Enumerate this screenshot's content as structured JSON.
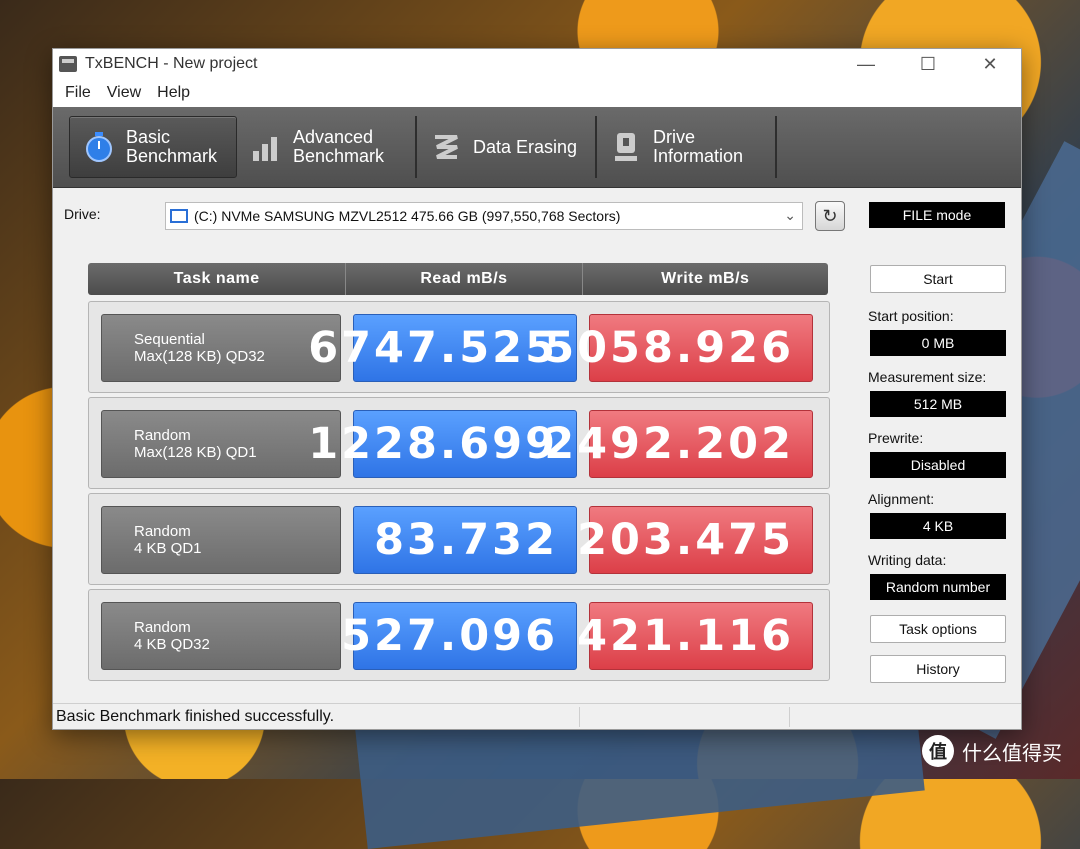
{
  "window": {
    "title": "TxBENCH - New project"
  },
  "menu": [
    "File",
    "View",
    "Help"
  ],
  "tabs": [
    {
      "line1": "Basic",
      "line2": "Benchmark",
      "icon": "stopwatch-icon"
    },
    {
      "line1": "Advanced",
      "line2": "Benchmark",
      "icon": "bar-chart-icon"
    },
    {
      "line1": "Data Erasing",
      "line2": "",
      "icon": "eraser-icon"
    },
    {
      "line1": "Drive",
      "line2": "Information",
      "icon": "drive-info-icon"
    }
  ],
  "drive": {
    "label": "Drive:",
    "value": "(C:) NVMe SAMSUNG MZVL2512  475.66 GB (997,550,768 Sectors)",
    "mode": "FILE mode"
  },
  "table": {
    "headers": [
      "Task name",
      "Read mB/s",
      "Write mB/s"
    ],
    "rows": [
      {
        "line1": "Sequential",
        "line2": "Max(128 KB) QD32",
        "read": "6747.525",
        "write": "5058.926"
      },
      {
        "line1": "Random",
        "line2": "Max(128 KB) QD1",
        "read": "1228.699",
        "write": "2492.202"
      },
      {
        "line1": "Random",
        "line2": "4 KB QD1",
        "read": "83.732",
        "write": "203.475"
      },
      {
        "line1": "Random",
        "line2": "4 KB QD32",
        "read": "527.096",
        "write": "421.116"
      }
    ]
  },
  "side": {
    "start": "Start",
    "start_position_label": "Start position:",
    "start_position": "0 MB",
    "measurement_size_label": "Measurement size:",
    "measurement_size": "512 MB",
    "prewrite_label": "Prewrite:",
    "prewrite": "Disabled",
    "alignment_label": "Alignment:",
    "alignment": "4 KB",
    "writing_data_label": "Writing data:",
    "writing_data": "Random number",
    "task_options": "Task options",
    "history": "History"
  },
  "status": "Basic Benchmark finished successfully.",
  "watermark": {
    "icon_text": "值",
    "text": "什么值得买"
  }
}
